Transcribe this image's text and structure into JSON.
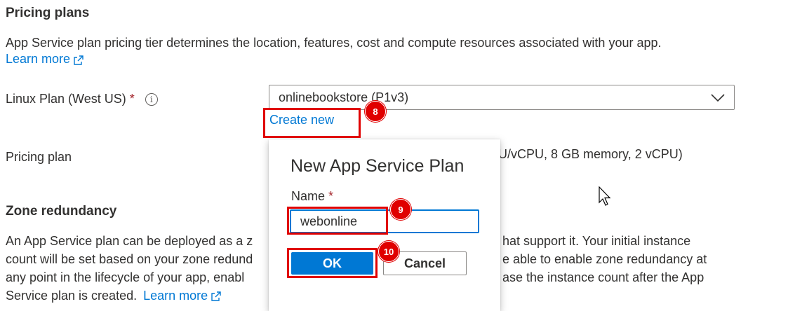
{
  "pricing_section": {
    "title": "Pricing plans",
    "description": "App Service plan pricing tier determines the location, features, cost and compute resources associated with your app.",
    "learn_more": "Learn more"
  },
  "linux_plan": {
    "label": "Linux Plan (West US)",
    "required_mark": "*",
    "info_glyph": "i",
    "selected_value": "onlinebookstore (P1v3)",
    "create_new": "Create new"
  },
  "pricing_plan": {
    "label": "Pricing plan",
    "value_partial": "U/vCPU, 8 GB memory, 2 vCPU)"
  },
  "zone_section": {
    "title": "Zone redundancy",
    "lines": [
      {
        "left": "An App Service plan can be deployed as a z",
        "right": "hat support it. Your initial instance"
      },
      {
        "left": "count will be set based on your zone redund",
        "right": "e able to enable zone redundancy at"
      },
      {
        "left": "any point in the lifecycle of your app, enabl",
        "right": "ase the instance count after the App"
      }
    ],
    "last_line": "Service plan is created.",
    "learn_more": "Learn more"
  },
  "dialog": {
    "title": "New App Service Plan",
    "name_label": "Name",
    "required_mark": "*",
    "name_value": "webonline",
    "ok_label": "OK",
    "cancel_label": "Cancel"
  },
  "annotations": {
    "step_8": "8",
    "step_9": "9",
    "step_10": "10",
    "color": "#e00000"
  },
  "colors": {
    "link": "#0078d4",
    "primary_button": "#0078d4",
    "required": "#a4262c",
    "text": "#323130"
  }
}
